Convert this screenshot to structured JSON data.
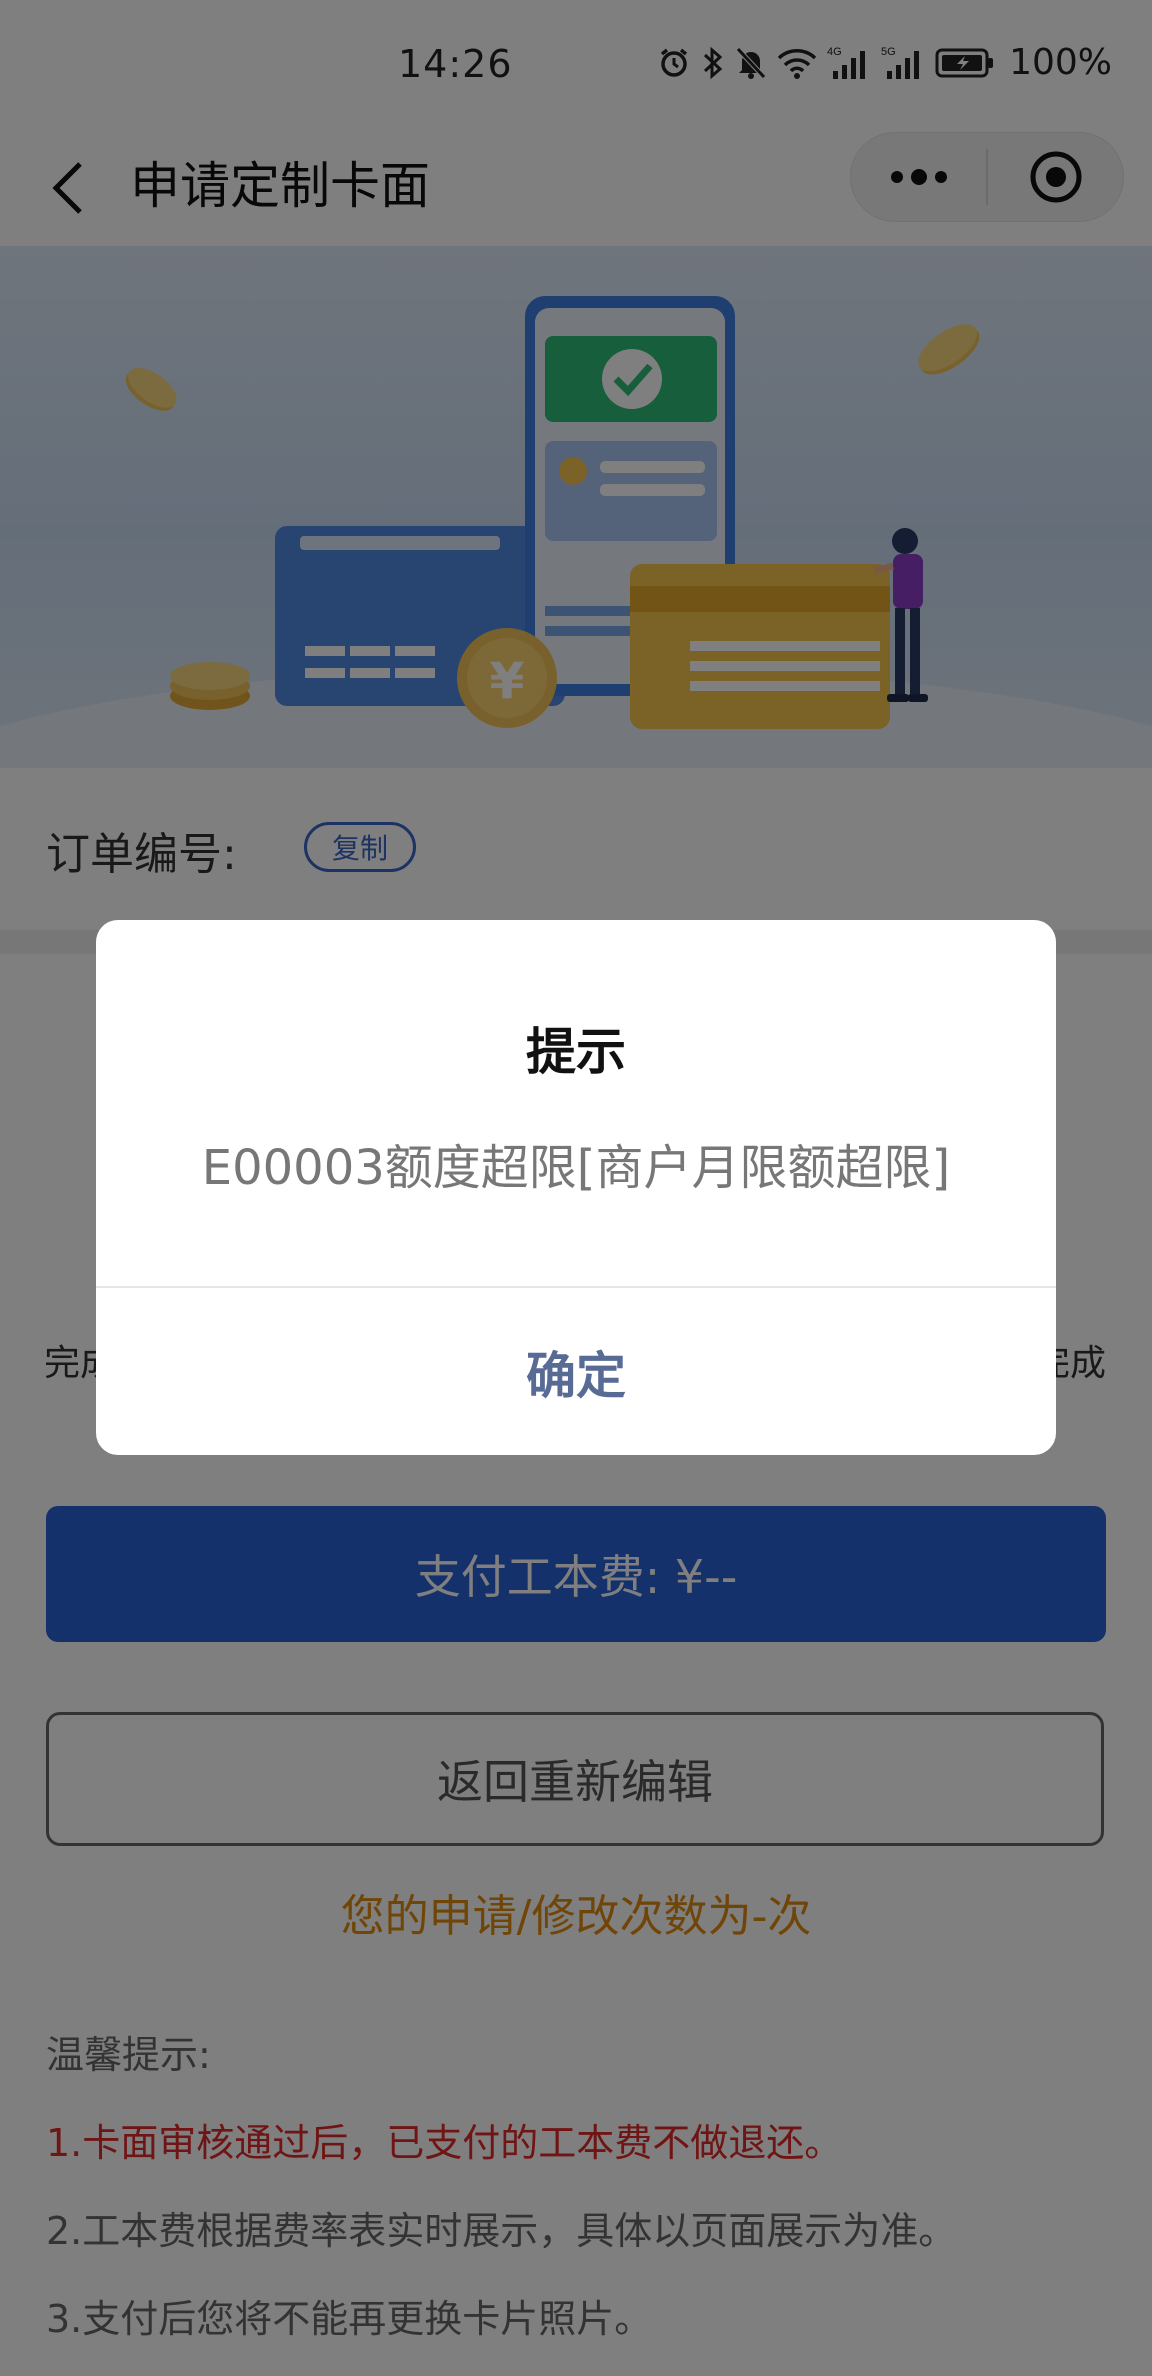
{
  "status_bar": {
    "time": "14:26",
    "battery": "100%",
    "icons": [
      "alarm-icon",
      "bluetooth-icon",
      "mute-bell-icon",
      "wifi-icon",
      "signal-4g-icon",
      "signal-5g-icon",
      "battery-icon"
    ],
    "network_labels": [
      "4G",
      "5G"
    ]
  },
  "nav": {
    "title": "申请定制卡面",
    "back_icon": "chevron-left-icon",
    "more_icon": "more-dots-icon",
    "close_icon": "target-close-icon"
  },
  "banner": {
    "coin_symbol": "¥"
  },
  "order": {
    "label": "订单编号:",
    "copy_label": "复制"
  },
  "content": {
    "cut_left": "完成",
    "cut_right": "完成"
  },
  "actions": {
    "pay_label": "支付工本费: ¥--",
    "reedit_label": "返回重新编辑",
    "count_text": "您的申请/修改次数为-次"
  },
  "tips": {
    "title": "温馨提示:",
    "items": [
      "1.卡面审核通过后，已支付的工本费不做退还。",
      "2.工本费根据费率表实时展示，具体以页面展示为准。",
      "3.支付后您将不能再更换卡片照片。"
    ]
  },
  "dialog": {
    "title": "提示",
    "message": "E00003额度超限[商户月限额超限]",
    "confirm_label": "确定"
  },
  "colors": {
    "primary_blue": "#2a63d6",
    "warning_orange": "#e08a10",
    "alert_red": "#e02a2a",
    "dialog_button": "#576b95"
  }
}
